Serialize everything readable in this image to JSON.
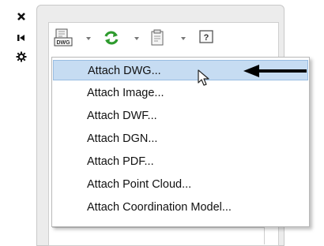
{
  "left_strip": {
    "close_icon": "close-icon",
    "pin_icon": "pin-icon",
    "settings_icon": "gear-icon"
  },
  "toolbar": {
    "attach_icon_label": "DWG",
    "buttons": [
      {
        "name": "attach-dwg-icon"
      },
      {
        "name": "refresh-icon"
      },
      {
        "name": "clipboard-icon"
      },
      {
        "name": "help-icon"
      }
    ],
    "help_label": "?"
  },
  "menu": {
    "items": [
      {
        "label": "Attach DWG...",
        "highlighted": true
      },
      {
        "label": "Attach Image..."
      },
      {
        "label": "Attach DWF..."
      },
      {
        "label": "Attach DGN..."
      },
      {
        "label": "Attach PDF..."
      },
      {
        "label": "Attach Point Cloud..."
      },
      {
        "label": "Attach Coordination Model..."
      }
    ]
  },
  "colors": {
    "highlight": "#c6dcf2",
    "refresh_green": "#2e9b2e"
  }
}
